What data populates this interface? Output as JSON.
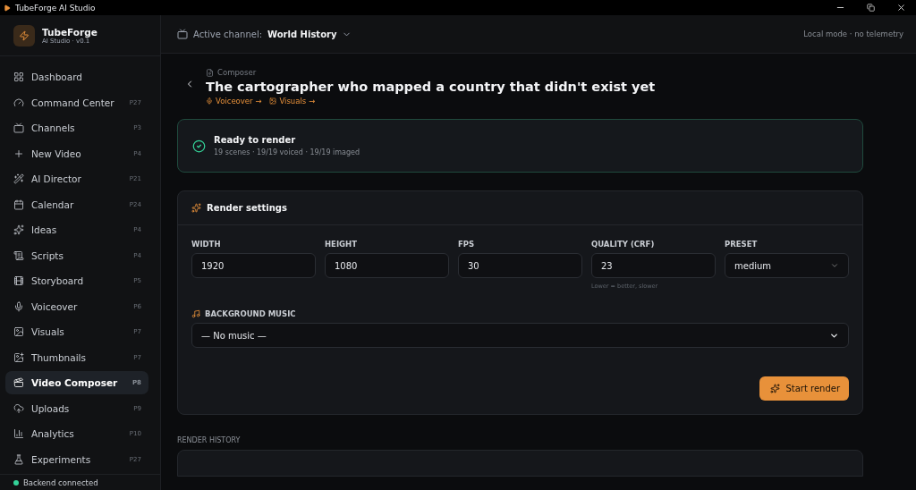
{
  "window": {
    "title": "TubeForge AI Studio"
  },
  "brand": {
    "name": "TubeForge",
    "subtitle": "AI Studio · v0.1"
  },
  "sidebar": {
    "items": [
      {
        "label": "Dashboard",
        "selected": false
      },
      {
        "label": "Command Center",
        "badge": "P27",
        "selected": false
      },
      {
        "label": "Channels",
        "badge": "P3",
        "selected": false
      },
      {
        "label": "New Video",
        "badge": "P4",
        "selected": false
      },
      {
        "label": "AI Director",
        "badge": "P21",
        "selected": false
      },
      {
        "label": "Calendar",
        "badge": "P24",
        "selected": false
      },
      {
        "label": "Ideas",
        "badge": "P4",
        "selected": false
      },
      {
        "label": "Scripts",
        "badge": "P4",
        "selected": false
      },
      {
        "label": "Storyboard",
        "badge": "P5",
        "selected": false
      },
      {
        "label": "Voiceover",
        "badge": "P6",
        "selected": false
      },
      {
        "label": "Visuals",
        "badge": "P7",
        "selected": false
      },
      {
        "label": "Thumbnails",
        "badge": "P7",
        "selected": false
      },
      {
        "label": "Video Composer",
        "badge": "P8",
        "selected": true
      },
      {
        "label": "Uploads",
        "badge": "P9",
        "selected": false
      },
      {
        "label": "Analytics",
        "badge": "P10",
        "selected": false
      },
      {
        "label": "Experiments",
        "badge": "P27",
        "selected": false
      }
    ],
    "status": {
      "label": "Backend connected",
      "color": "#34d399"
    }
  },
  "header": {
    "channel_label": "Active channel:",
    "channel_name": "World History",
    "mode": "Local mode · no telemetry"
  },
  "page": {
    "breadcrumb": "Composer",
    "title": "The cartographer who mapped a country that didn't exist yet",
    "links": [
      "Voiceover →",
      "Visuals →"
    ]
  },
  "status_card": {
    "title": "Ready to render",
    "detail": "19 scenes · 19/19 voiced · 19/19 imaged"
  },
  "render_settings": {
    "title": "Render settings",
    "fields": [
      {
        "label": "WIDTH",
        "value": "1920",
        "kind": "input"
      },
      {
        "label": "HEIGHT",
        "value": "1080",
        "kind": "input"
      },
      {
        "label": "FPS",
        "value": "30",
        "kind": "input"
      },
      {
        "label": "QUALITY (CRF)",
        "value": "23",
        "kind": "input",
        "hint": "Lower = better, slower"
      },
      {
        "label": "PRESET",
        "value": "medium",
        "kind": "select"
      }
    ],
    "music_label": "BACKGROUND MUSIC",
    "music_value": "— No music —",
    "button": "Start render"
  },
  "render_history": {
    "title": "RENDER HISTORY"
  }
}
